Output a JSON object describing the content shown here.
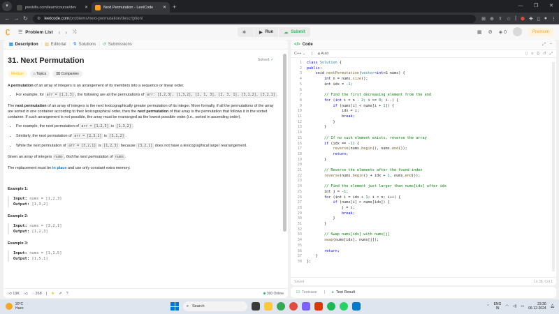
{
  "browser": {
    "tabs": [
      {
        "title": "pwskills.com/learn/course/dev",
        "favicon_color": "#4a4a4a",
        "active": false
      },
      {
        "title": "Next Permutation - LeetCode",
        "favicon_color": "#f89f1b",
        "active": true
      }
    ],
    "url_host": "leetcode.com",
    "url_path": "/problems/next-permutation/description/"
  },
  "header": {
    "problem_list": "Problem List",
    "run": "Run",
    "submit": "Submit",
    "streak_count": "0",
    "premium": "Premium"
  },
  "left_tabs": {
    "description": "Description",
    "editorial": "Editorial",
    "solutions": "Solutions",
    "submissions": "Submissions"
  },
  "problem": {
    "title": "31. Next Permutation",
    "status": "Solved",
    "difficulty": "Medium",
    "topics": "Topics",
    "companies": "Companies",
    "p1_a": "A ",
    "p1_b": "permutation",
    "p1_c": " of an array of integers is an arrangement of its members into a sequence or linear order.",
    "li1_a": "For example, for ",
    "li1_code": "arr = [1,2,3]",
    "li1_b": ", the following are all the permutations of ",
    "li1_codes": "arr: [1,2,3], [1,3,2], [2, 1, 3], [2, 3, 1], [3,1,2], [3,2,1]",
    "li1_c": ".",
    "p2_a": "The ",
    "p2_b": "next permutation",
    "p2_c": " of an array of integers is the next lexicographically greater permutation of its integer. More formally, if all the permutations of the array are sorted in one container according to their lexicographical order, then the ",
    "p2_d": "next permutation",
    "p2_e": " of that array is the permutation that follows it in the sorted container. If such arrangement is not possible, the array must be rearranged as the lowest possible order (i.e., sorted in ascending order).",
    "li2_a": "For example, the next permutation of ",
    "li2_code1": "arr = [1,2,3]",
    "li2_b": " is ",
    "li2_code2": "[1,3,2]",
    "li2_c": ".",
    "li3_a": "Similarly, the next permutation of ",
    "li3_code1": "arr = [2,3,1]",
    "li3_b": " is ",
    "li3_code2": "[3,1,2]",
    "li3_c": ".",
    "li4_a": "While the next permutation of ",
    "li4_code1": "arr = [3,2,1]",
    "li4_b": " is ",
    "li4_code2": "[1,2,3]",
    "li4_c": " because ",
    "li4_code3": "[3,2,1]",
    "li4_d": " does not have a lexicographical larger rearrangement.",
    "p3_a": "Given an array of integers ",
    "p3_code": "nums",
    "p3_b": ", find the next permutation of ",
    "p3_code2": "nums",
    "p3_c": ".",
    "p4_a": "The replacement must be ",
    "p4_b": "in place",
    "p4_c": " and use only constant extra memory.",
    "examples": [
      {
        "title": "Example 1:",
        "input_label": "Input:",
        "input": "nums = [1,2,3]",
        "output_label": "Output:",
        "output": "[1,3,2]"
      },
      {
        "title": "Example 2:",
        "input_label": "Input:",
        "input": "nums = [3,2,1]",
        "output_label": "Output:",
        "output": "[1,2,3]"
      },
      {
        "title": "Example 3:",
        "input_label": "Input:",
        "input": "nums = [1,1,5]",
        "output_label": "Output:",
        "output": "[1,5,1]"
      }
    ]
  },
  "footer": {
    "likes": "19K",
    "comments": "268",
    "online": "300 Online"
  },
  "editor": {
    "title": "Code",
    "language": "C++",
    "mode": "Auto",
    "saved": "Saved",
    "cursor": "Ln 38, Col 1",
    "lines": [
      [
        [
          "kw",
          "class "
        ],
        [
          "ty",
          "Solution"
        ],
        [
          "pl",
          " {"
        ]
      ],
      [
        [
          "kw",
          "public"
        ],
        [
          "pl",
          ":"
        ]
      ],
      [
        [
          "pl",
          "    "
        ],
        [
          "kw",
          "void "
        ],
        [
          "fn",
          "nextPermutation"
        ],
        [
          "pl",
          "("
        ],
        [
          "ty",
          "vector"
        ],
        [
          "pl",
          "<"
        ],
        [
          "kw",
          "int"
        ],
        [
          "pl",
          ">& nums) {"
        ]
      ],
      [
        [
          "pl",
          "        "
        ],
        [
          "kw",
          "int "
        ],
        [
          "pl",
          "n = nums."
        ],
        [
          "fn",
          "size"
        ],
        [
          "pl",
          "();"
        ]
      ],
      [
        [
          "pl",
          "        "
        ],
        [
          "kw",
          "int "
        ],
        [
          "pl",
          "idx = -"
        ],
        [
          "nm",
          "1"
        ],
        [
          "pl",
          ";"
        ]
      ],
      [],
      [
        [
          "pl",
          "        "
        ],
        [
          "cm",
          "// Find the first decreasing element from the end"
        ]
      ],
      [
        [
          "pl",
          "        "
        ],
        [
          "kw",
          "for "
        ],
        [
          "pl",
          "("
        ],
        [
          "kw",
          "int "
        ],
        [
          "pl",
          "i = n - "
        ],
        [
          "nm",
          "2"
        ],
        [
          "pl",
          "; i >= "
        ],
        [
          "nm",
          "0"
        ],
        [
          "pl",
          "; i--) {"
        ]
      ],
      [
        [
          "pl",
          "            "
        ],
        [
          "kw",
          "if "
        ],
        [
          "pl",
          "(nums[i] < nums[i + "
        ],
        [
          "nm",
          "1"
        ],
        [
          "pl",
          "]) {"
        ]
      ],
      [
        [
          "pl",
          "                idx = i;"
        ]
      ],
      [
        [
          "pl",
          "                "
        ],
        [
          "kw",
          "break"
        ],
        [
          "pl",
          ";"
        ]
      ],
      [
        [
          "pl",
          "            }"
        ]
      ],
      [
        [
          "pl",
          "        }"
        ]
      ],
      [],
      [
        [
          "pl",
          "        "
        ],
        [
          "cm",
          "// If no such element exists, reverse the array"
        ]
      ],
      [
        [
          "pl",
          "        "
        ],
        [
          "kw",
          "if "
        ],
        [
          "pl",
          "(idx == -"
        ],
        [
          "nm",
          "1"
        ],
        [
          "pl",
          ") {"
        ]
      ],
      [
        [
          "pl",
          "            "
        ],
        [
          "fn",
          "reverse"
        ],
        [
          "pl",
          "(nums."
        ],
        [
          "fn",
          "begin"
        ],
        [
          "pl",
          "(), nums."
        ],
        [
          "fn",
          "end"
        ],
        [
          "pl",
          "());"
        ]
      ],
      [
        [
          "pl",
          "            "
        ],
        [
          "kw",
          "return"
        ],
        [
          "pl",
          ";"
        ]
      ],
      [
        [
          "pl",
          "        }"
        ]
      ],
      [],
      [
        [
          "pl",
          "        "
        ],
        [
          "cm",
          "// Reverse the elements after the found index"
        ]
      ],
      [
        [
          "pl",
          "        "
        ],
        [
          "fn",
          "reverse"
        ],
        [
          "pl",
          "(nums."
        ],
        [
          "fn",
          "begin"
        ],
        [
          "pl",
          "() + idx + "
        ],
        [
          "nm",
          "1"
        ],
        [
          "pl",
          ", nums."
        ],
        [
          "fn",
          "end"
        ],
        [
          "pl",
          "());"
        ]
      ],
      [],
      [
        [
          "pl",
          "        "
        ],
        [
          "cm",
          "// Find the element just larger than nums[idx] after idx"
        ]
      ],
      [
        [
          "pl",
          "        "
        ],
        [
          "kw",
          "int "
        ],
        [
          "pl",
          "j = -"
        ],
        [
          "nm",
          "1"
        ],
        [
          "pl",
          ";"
        ]
      ],
      [
        [
          "pl",
          "        "
        ],
        [
          "kw",
          "for "
        ],
        [
          "pl",
          "("
        ],
        [
          "kw",
          "int "
        ],
        [
          "pl",
          "i = idx + "
        ],
        [
          "nm",
          "1"
        ],
        [
          "pl",
          "; i < n; i++) {"
        ]
      ],
      [
        [
          "pl",
          "            "
        ],
        [
          "kw",
          "if "
        ],
        [
          "pl",
          "(nums[i] > nums[idx]) {"
        ]
      ],
      [
        [
          "pl",
          "                j = i;"
        ]
      ],
      [
        [
          "pl",
          "                "
        ],
        [
          "kw",
          "break"
        ],
        [
          "pl",
          ";"
        ]
      ],
      [
        [
          "pl",
          "            }"
        ]
      ],
      [
        [
          "pl",
          "        }"
        ]
      ],
      [],
      [
        [
          "pl",
          "        "
        ],
        [
          "cm",
          "// Swap nums[idx] with nums[j]"
        ]
      ],
      [
        [
          "pl",
          "        "
        ],
        [
          "fn",
          "swap"
        ],
        [
          "pl",
          "(nums[idx], nums[j]);"
        ]
      ],
      [],
      [
        [
          "pl",
          "        "
        ],
        [
          "kw",
          "return"
        ],
        [
          "pl",
          ";"
        ]
      ],
      [
        [
          "pl",
          "    }"
        ]
      ],
      [
        [
          "pl",
          "};"
        ]
      ]
    ]
  },
  "bottom_tabs": {
    "testcase": "Testcase",
    "test_result": "Test Result"
  },
  "taskbar": {
    "temp": "20°C",
    "weather": "Haze",
    "search": "Search",
    "lang1": "ENG",
    "lang2": "IN",
    "time": "23:30",
    "date": "06-12-2024"
  }
}
